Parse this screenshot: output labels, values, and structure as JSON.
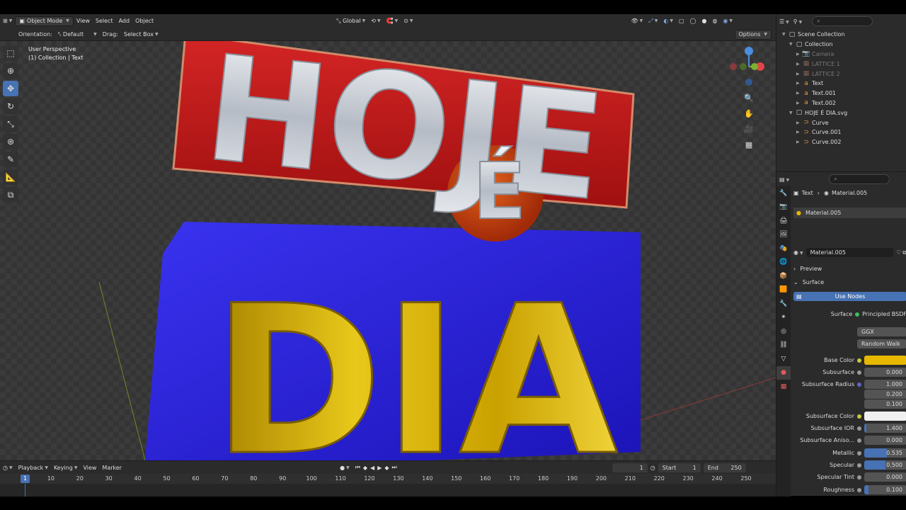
{
  "header": {
    "mode": "Object Mode",
    "menus": [
      "View",
      "Select",
      "Add",
      "Object"
    ],
    "transform": "Global",
    "orientation_label": "Orientation:",
    "orientation_value": "Default",
    "drag_label": "Drag:",
    "drag_value": "Select Box",
    "options": "Options"
  },
  "viewport": {
    "info_line1": "User Perspective",
    "info_line2": "(1) Collection | Text",
    "title_top": "HOJE",
    "title_mid": "É",
    "title_bottom": "DIA"
  },
  "timeline": {
    "menus": [
      "Playback",
      "Keying",
      "View",
      "Marker"
    ],
    "current_frame": "1",
    "start_label": "Start",
    "start_value": "1",
    "end_label": "End",
    "end_value": "250",
    "ticks": [
      "1",
      "10",
      "20",
      "30",
      "40",
      "50",
      "60",
      "70",
      "80",
      "90",
      "100",
      "110",
      "120",
      "130",
      "140",
      "150",
      "160",
      "170",
      "180",
      "190",
      "200",
      "210",
      "220",
      "230",
      "240",
      "250"
    ]
  },
  "outliner": {
    "rows": [
      {
        "label": "Scene Collection",
        "indent": 0,
        "icon": "box-icon",
        "dim": false
      },
      {
        "label": "Collection",
        "indent": 1,
        "icon": "box-icon",
        "dim": false
      },
      {
        "label": "Camera",
        "indent": 2,
        "icon": "camera-icon",
        "dim": true
      },
      {
        "label": "LATTICE 1",
        "indent": 2,
        "icon": "lattice-icon",
        "dim": true
      },
      {
        "label": "LATTICE 2",
        "indent": 2,
        "icon": "lattice-icon",
        "dim": true
      },
      {
        "label": "Text",
        "indent": 2,
        "icon": "text-icon",
        "dim": false
      },
      {
        "label": "Text.001",
        "indent": 2,
        "icon": "text-icon",
        "dim": false
      },
      {
        "label": "Text.002",
        "indent": 2,
        "icon": "text-icon",
        "dim": false
      },
      {
        "label": "HOJE É DIA.svg",
        "indent": 1,
        "icon": "box-icon",
        "dim": false
      },
      {
        "label": "Curve",
        "indent": 2,
        "icon": "curve-icon",
        "dim": false
      },
      {
        "label": "Curve.001",
        "indent": 2,
        "icon": "curve-icon",
        "dim": false
      },
      {
        "label": "Curve.002",
        "indent": 2,
        "icon": "curve-icon",
        "dim": false
      }
    ]
  },
  "properties": {
    "breadcrumb_object": "Text",
    "breadcrumb_material": "Material.005",
    "slot": "Material.005",
    "material_name": "Material.005",
    "preview": "Preview",
    "surface": "Surface",
    "use_nodes": "Use Nodes",
    "surface_label": "Surface",
    "surface_value": "Principled BSDF",
    "distribution": "GGX",
    "subsurface_method": "Random Walk",
    "fields": [
      {
        "label": "Base Color",
        "value": "",
        "fill": 0,
        "color": "#e8b800",
        "dot": "#c8c83c"
      },
      {
        "label": "Subsurface",
        "value": "0.000",
        "fill": 0,
        "color": "",
        "dot": "#999"
      },
      {
        "label": "Subsurface Radius",
        "value": "1.000",
        "fill": 0,
        "color": "",
        "dot": "#6363c7"
      },
      {
        "label": "",
        "value": "0.200",
        "fill": 0,
        "color": "",
        "dot": ""
      },
      {
        "label": "",
        "value": "0.100",
        "fill": 0,
        "color": "",
        "dot": ""
      },
      {
        "label": "Subsurface Color",
        "value": "",
        "fill": 0,
        "color": "#f0f0f0",
        "dot": "#c8c83c"
      },
      {
        "label": "Subsurface IOR",
        "value": "1.400",
        "fill": 0.05,
        "color": "",
        "dot": "#999"
      },
      {
        "label": "Subsurface Aniso...",
        "value": "0.000",
        "fill": 0,
        "color": "",
        "dot": "#999"
      },
      {
        "label": "Metallic",
        "value": "0.535",
        "fill": 0.535,
        "color": "",
        "dot": "#999"
      },
      {
        "label": "Specular",
        "value": "0.500",
        "fill": 0.5,
        "color": "",
        "dot": "#999"
      },
      {
        "label": "Specular Tint",
        "value": "0.000",
        "fill": 0,
        "color": "",
        "dot": "#999"
      },
      {
        "label": "Roughness",
        "value": "0.100",
        "fill": 0.1,
        "color": "",
        "dot": "#999"
      }
    ]
  },
  "colors": {
    "accent": "#4772b3",
    "red_plate": "#c31a1a",
    "blue_plate": "#2a22d8",
    "gold": "#d9b20c",
    "silver": "#cfd3d9"
  }
}
